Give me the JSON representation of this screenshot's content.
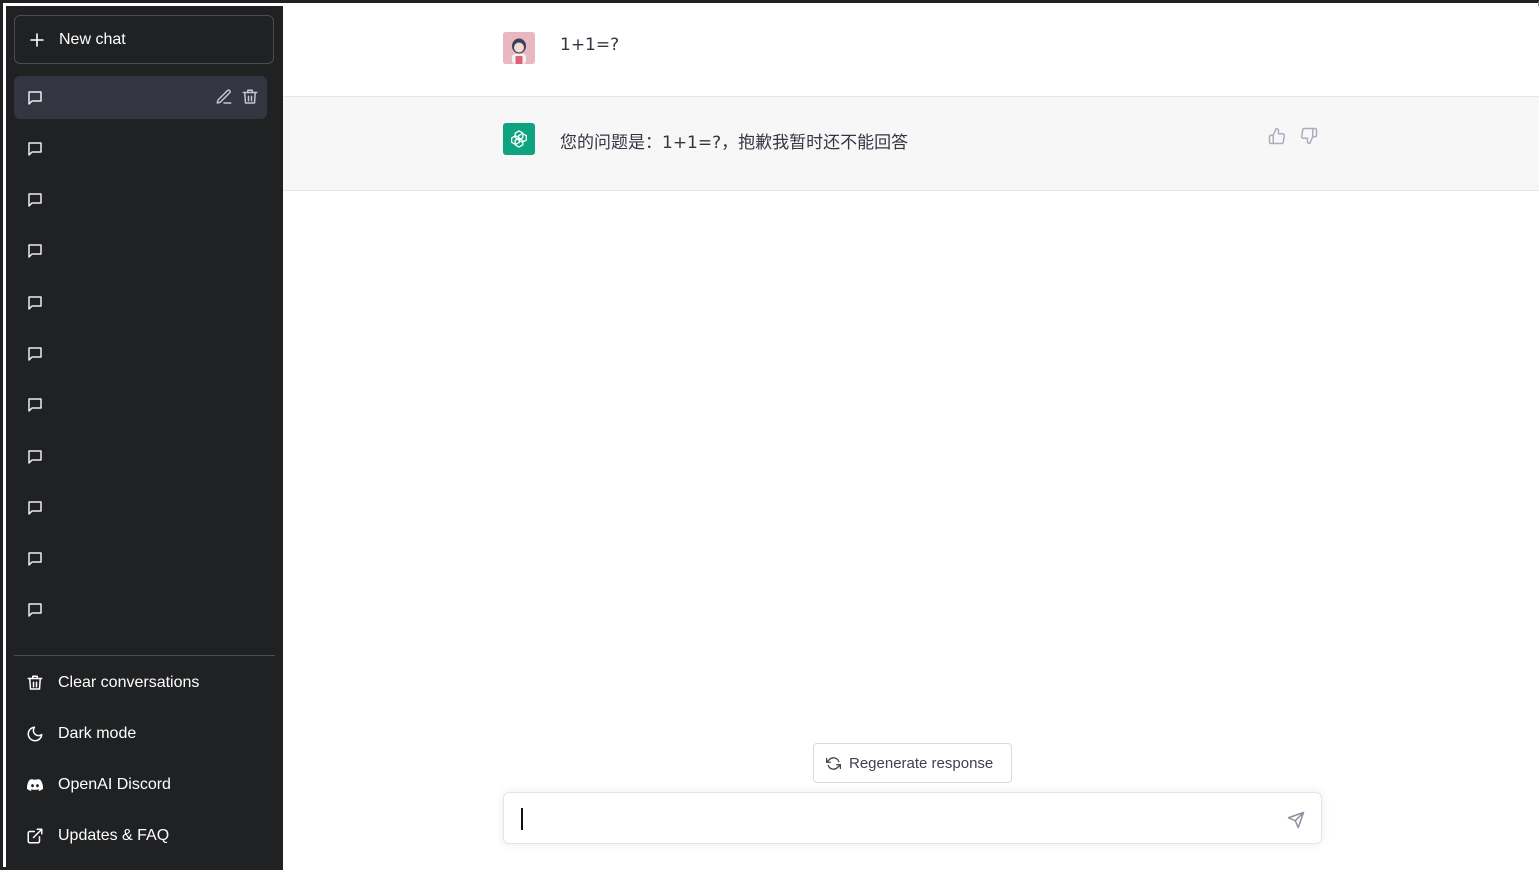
{
  "sidebar": {
    "new_chat_label": "New chat",
    "conversations": [
      {
        "title": "",
        "active": true
      },
      {
        "title": ""
      },
      {
        "title": ""
      },
      {
        "title": ""
      },
      {
        "title": ""
      },
      {
        "title": ""
      },
      {
        "title": ""
      },
      {
        "title": ""
      },
      {
        "title": ""
      },
      {
        "title": ""
      },
      {
        "title": ""
      },
      {
        "title": ""
      }
    ],
    "menu": {
      "clear_label": "Clear conversations",
      "dark_mode_label": "Dark mode",
      "discord_label": "OpenAI Discord",
      "faq_label": "Updates & FAQ"
    },
    "icons": [
      "plus-icon",
      "chat-bubble-icon",
      "edit-icon",
      "trash-icon",
      "moon-icon",
      "discord-icon",
      "external-link-icon"
    ]
  },
  "conversation": {
    "user_message": "1+1=?",
    "assistant_message": "您的问题是：1+1=?，抱歉我暂时还不能回答"
  },
  "composer": {
    "regenerate_label": "Regenerate response",
    "input_value": "",
    "input_placeholder": ""
  },
  "colors": {
    "sidebar_bg": "#202123",
    "active_item_bg": "#343541",
    "assistant_bg": "#f7f7f8",
    "brand_green": "#10a37f",
    "avatar_pink": "#e8b7c1"
  }
}
